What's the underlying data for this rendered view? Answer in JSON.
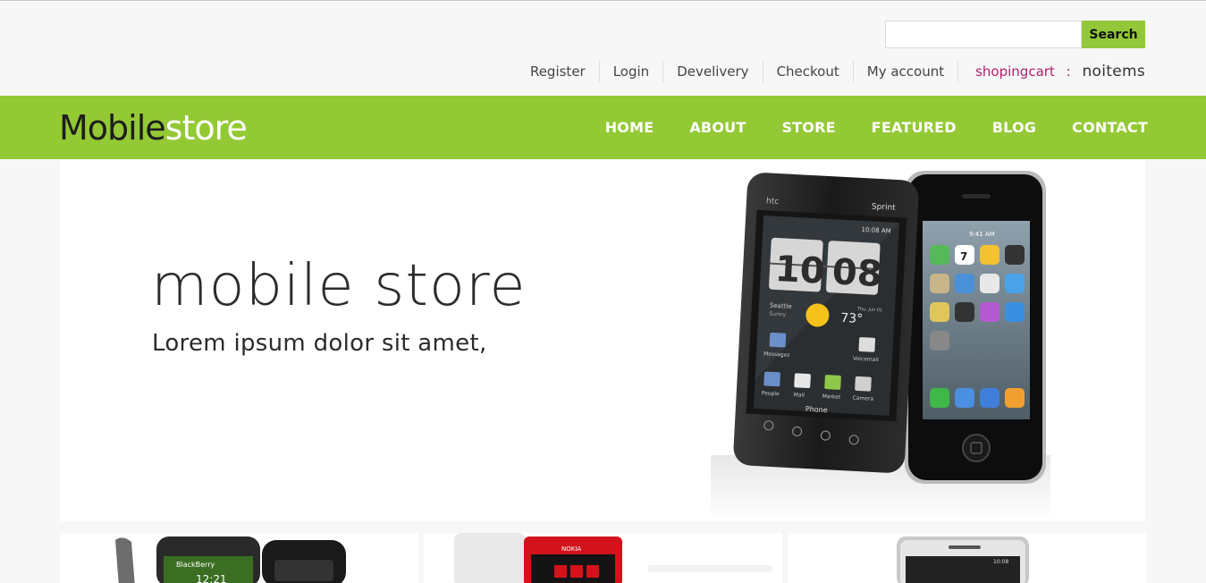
{
  "search": {
    "placeholder": "",
    "value": "",
    "button_label": "Search"
  },
  "top_links": [
    "Register",
    "Login",
    "Develivery",
    "Checkout",
    "My account"
  ],
  "cart": {
    "label": "shopingcart",
    "separator": ":",
    "value": "noitems"
  },
  "logo": {
    "part1": "Mobile",
    "part2": "store"
  },
  "nav": [
    "HOME",
    "ABOUT",
    "STORE",
    "FEATURED",
    "BLOG",
    "CONTACT"
  ],
  "hero": {
    "title": "mobile store",
    "subtitle": "Lorem ipsum dolor sit amet,"
  },
  "phones": {
    "htc_brand": "htc",
    "carrier": "Sprint",
    "status_time": "10:08 AM",
    "clock_hour": "10",
    "clock_min": "08",
    "city": "Seattle",
    "weather": "Sunny",
    "temp": "73°",
    "date": "Thu, Jun 01",
    "apps_top": [
      "Messages",
      "Voicemail"
    ],
    "apps_bottom": [
      "People",
      "Mail",
      "Market",
      "Camera"
    ],
    "phone_label": "Phone",
    "iphone_time": "9:41 AM",
    "iphone_date": "7"
  },
  "cards": [
    {
      "brand": "BlackBerry",
      "time": "12:21"
    },
    {
      "brand": "NOKIA"
    },
    {
      "time": "10:08"
    }
  ],
  "colors": {
    "accent": "#93c934",
    "cart": "#b0206e"
  }
}
